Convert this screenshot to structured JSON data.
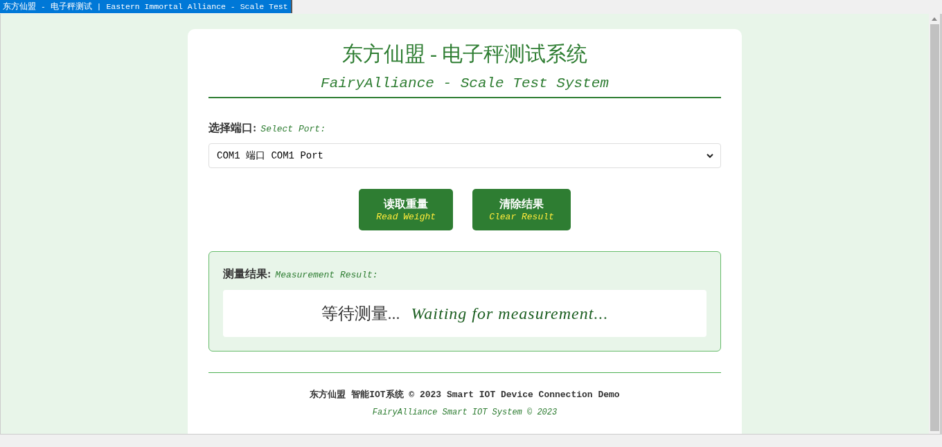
{
  "window": {
    "title": "东方仙盟 - 电子秤测试 | Eastern Immortal Alliance - Scale Test"
  },
  "header": {
    "title": "东方仙盟 - 电子秤测试系统",
    "subtitle": "FairyAlliance - Scale Test System"
  },
  "port": {
    "label": "选择端口:",
    "label_en": "Select Port:",
    "value": "COM1 端口 COM1 Port"
  },
  "buttons": [
    {
      "label": "读取重量",
      "label_en": "Read Weight"
    },
    {
      "label": "清除结果",
      "label_en": "Clear Result"
    }
  ],
  "result": {
    "label": "测量结果:",
    "label_en": "Measurement Result:",
    "value": "等待测量...",
    "value_en": "Waiting for measurement..."
  },
  "footer": {
    "line1": "东方仙盟 智能IOT系统 © 2023 Smart IOT Device Connection Demo",
    "line2": "FairyAlliance Smart IOT System © 2023"
  }
}
